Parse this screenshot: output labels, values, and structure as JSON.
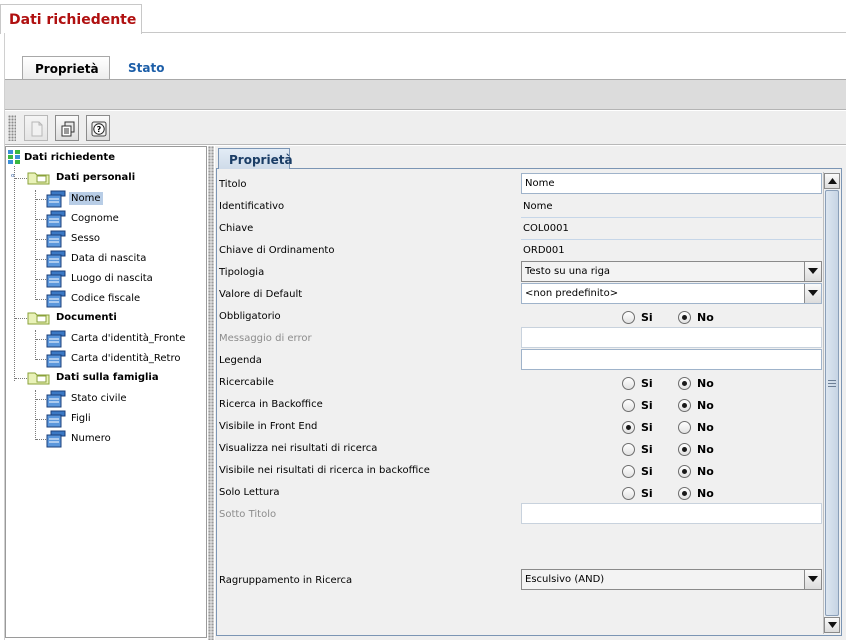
{
  "window_title": "Dati richiedente",
  "tabs": [
    {
      "label": "Proprietà",
      "active": true
    },
    {
      "label": "Stato",
      "active": false
    }
  ],
  "toolbar": [
    {
      "icon": "document-icon",
      "enabled": false
    },
    {
      "icon": "copy-icon",
      "enabled": true
    },
    {
      "icon": "help-icon",
      "enabled": true
    }
  ],
  "tree": {
    "root": "Dati richiedente",
    "groups": [
      {
        "label": "Dati personali",
        "items": [
          "Nome",
          "Cognome",
          "Sesso",
          "Data di nascita",
          "Luogo di nascita",
          "Codice fiscale"
        ]
      },
      {
        "label": "Documenti",
        "items": [
          "Carta d'identità_Fronte",
          "Carta d'identità_Retro"
        ]
      },
      {
        "label": "Dati sulla famiglia",
        "items": [
          "Stato civile",
          "Figli",
          "Numero"
        ]
      }
    ],
    "selected": "Nome"
  },
  "properties": {
    "tab_label": "Proprietà",
    "rows": {
      "titolo": {
        "label": "Titolo",
        "value": "Nome"
      },
      "identificativo": {
        "label": "Identificativo",
        "value": "Nome"
      },
      "chiave": {
        "label": "Chiave",
        "value": "COL0001"
      },
      "chiave_ordinamento": {
        "label": "Chiave di Ordinamento",
        "value": "ORD001"
      },
      "tipologia": {
        "label": "Tipologia",
        "value": "Testo su una riga"
      },
      "valore_default": {
        "label": "Valore di Default",
        "value": "<non predefinito>"
      },
      "obbligatorio": {
        "label": "Obbligatorio",
        "value": "No"
      },
      "messaggio_errore": {
        "label": "Messaggio di error",
        "value": ""
      },
      "legenda": {
        "label": "Legenda",
        "value": ""
      },
      "ricercabile": {
        "label": "Ricercabile",
        "value": "No"
      },
      "ricerca_backoffice": {
        "label": "Ricerca in Backoffice",
        "value": "No"
      },
      "visibile_front_end": {
        "label": "Visibile in Front End",
        "value": "Si"
      },
      "visualizza_risultati": {
        "label": "Visualizza nei risultati di ricerca",
        "value": "No"
      },
      "visibile_risultati_backoffice": {
        "label": "Visibile nei risultati di ricerca in backoffice",
        "value": "No"
      },
      "solo_lettura": {
        "label": "Solo Lettura",
        "value": "No"
      },
      "sotto_titolo": {
        "label": "Sotto Titolo",
        "value": ""
      },
      "raggruppamento": {
        "label": "Ragruppamento in Ricerca",
        "value": "Esculsivo (AND)"
      }
    },
    "radio_labels": {
      "yes": "Si",
      "no": "No"
    }
  }
}
